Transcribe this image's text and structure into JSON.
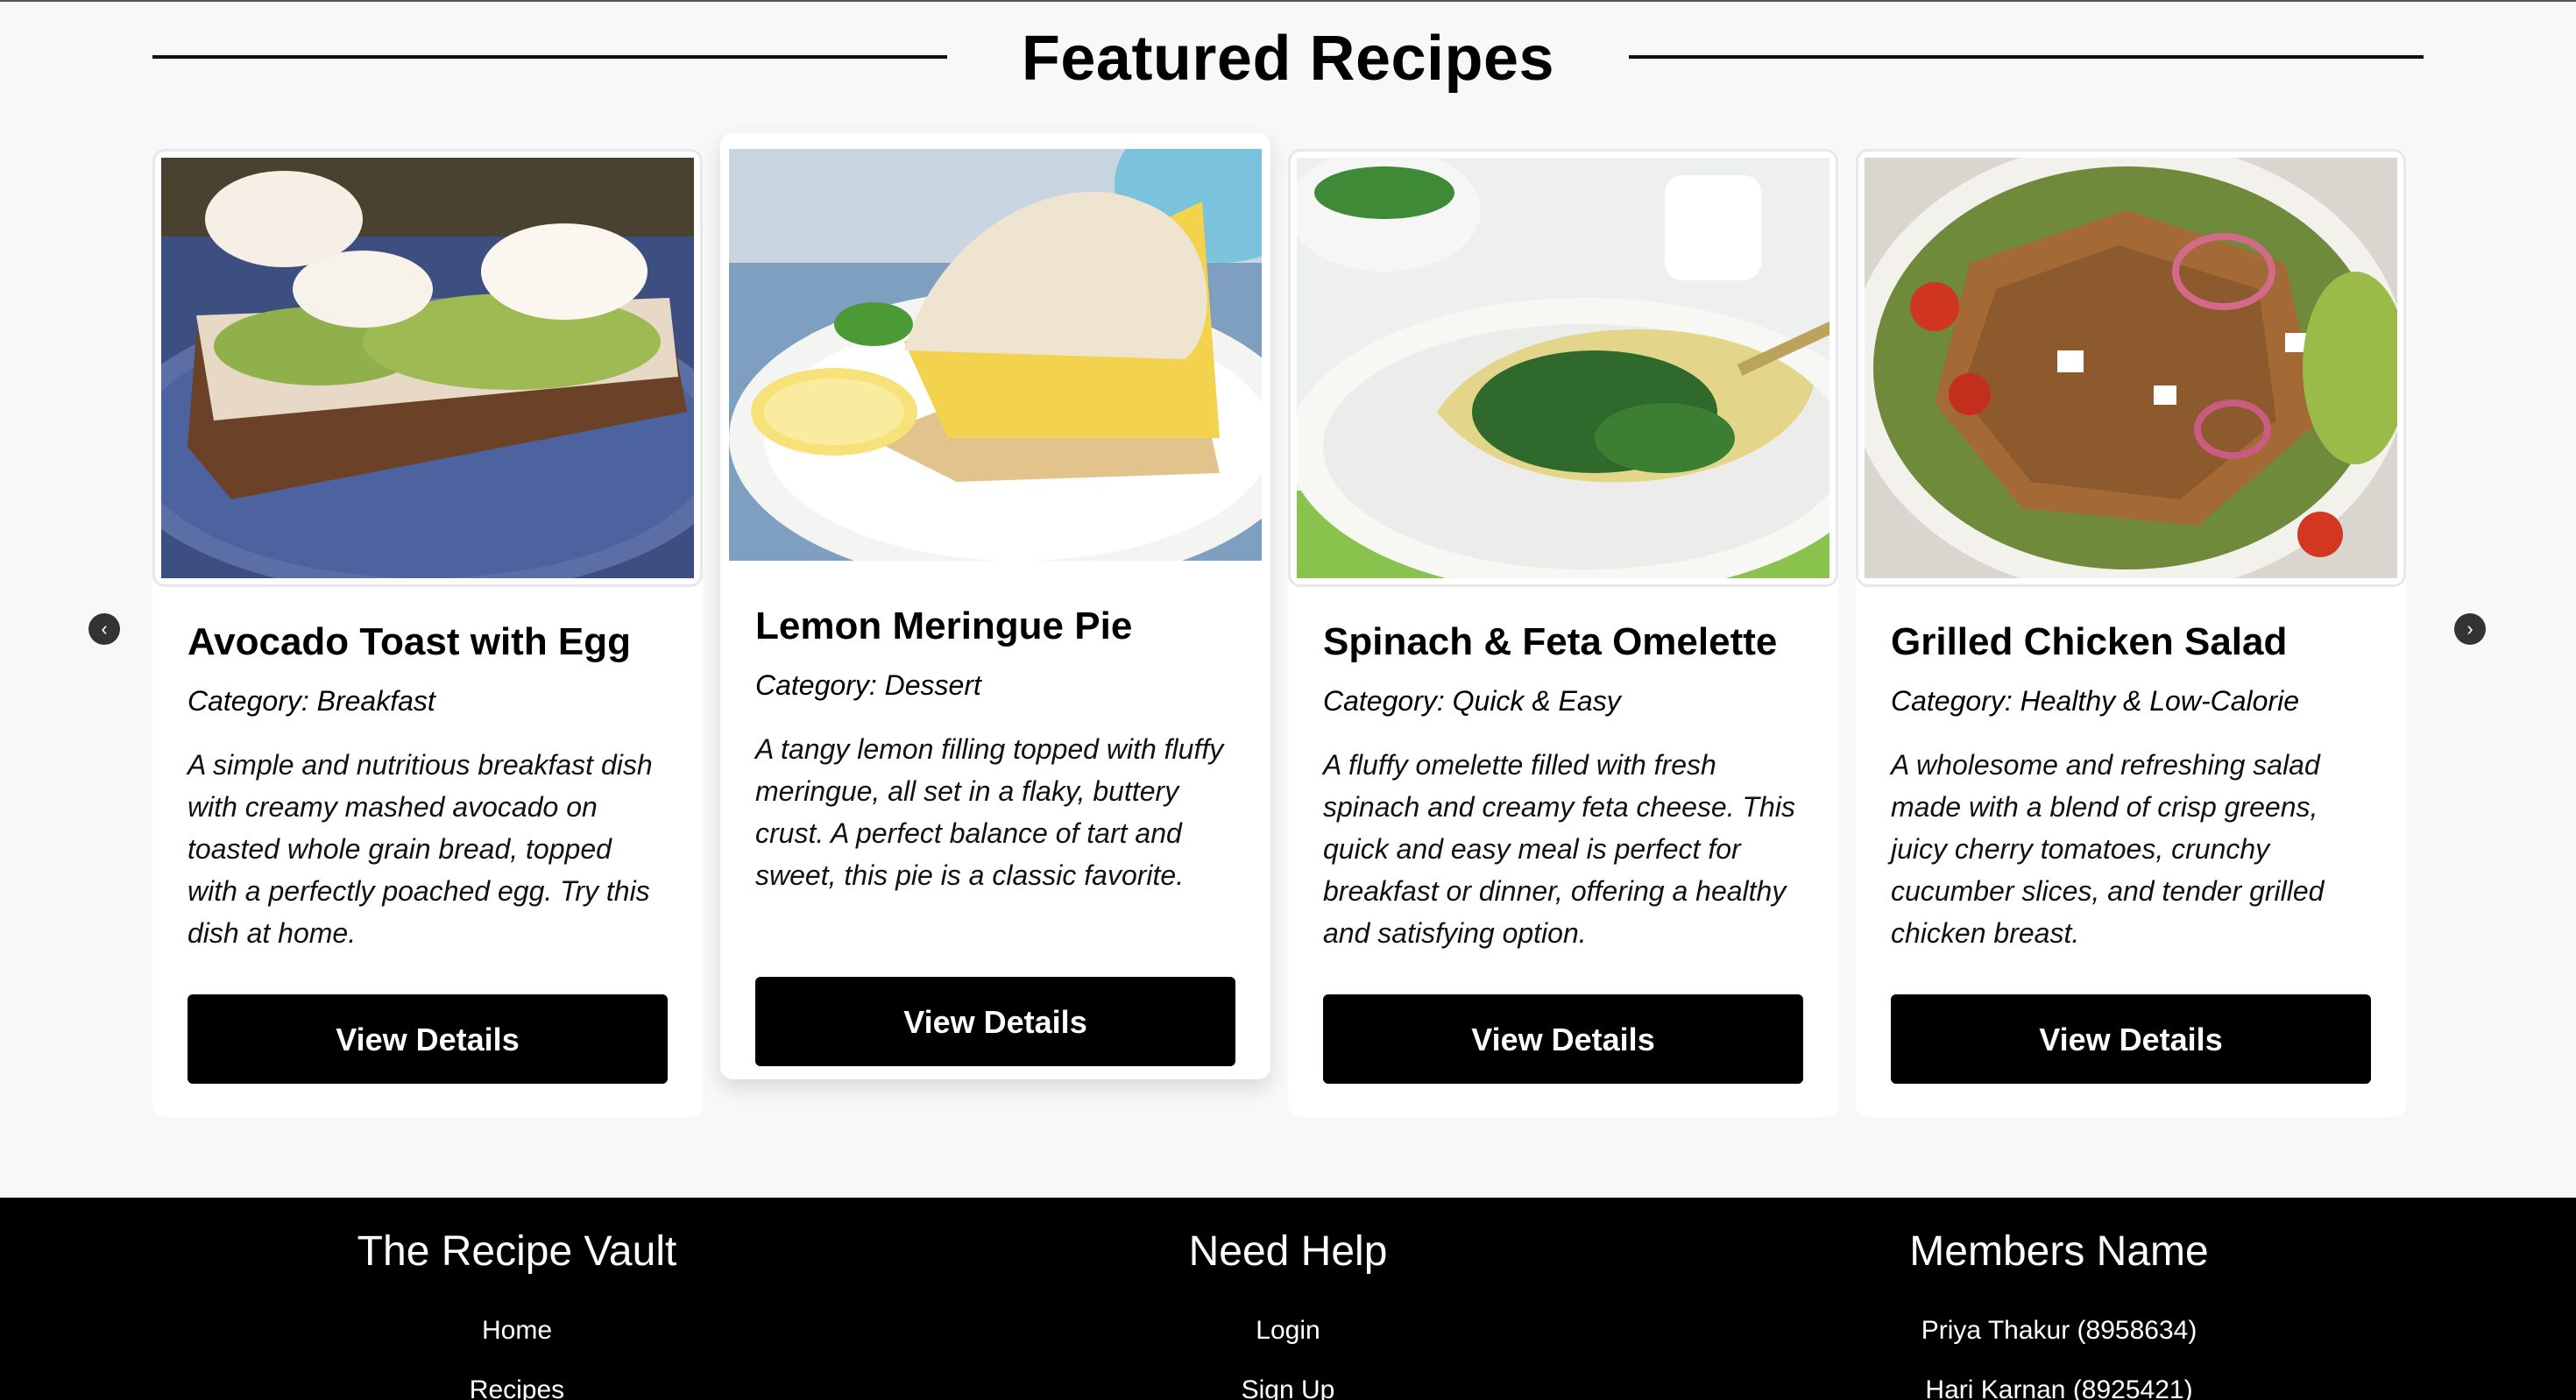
{
  "section": {
    "title": "Featured Recipes"
  },
  "carousel": {
    "prev_icon": "chevron-left-circle",
    "next_icon": "chevron-right-circle",
    "cards": [
      {
        "title": "Avocado Toast with Egg",
        "category": "Category: Breakfast",
        "description": "A simple and nutritious breakfast dish with creamy mashed avocado on toasted whole grain bread, topped with a perfectly poached egg. Try this dish at home.",
        "button": "View Details"
      },
      {
        "title": "Lemon Meringue Pie",
        "category": "Category: Dessert",
        "description": "A tangy lemon filling topped with fluffy meringue, all set in a flaky, buttery crust. A perfect balance of tart and sweet, this pie is a classic favorite.",
        "button": "View Details"
      },
      {
        "title": "Spinach & Feta Omelette",
        "category": "Category: Quick & Easy",
        "description": "A fluffy omelette filled with fresh spinach and creamy feta cheese. This quick and easy meal is perfect for breakfast or dinner, offering a healthy and satisfying option.",
        "button": "View Details"
      },
      {
        "title": "Grilled Chicken Salad",
        "category": "Category: Healthy & Low-Calorie",
        "description": "A wholesome and refreshing salad made with a blend of crisp greens, juicy cherry tomatoes, crunchy cucumber slices, and tender grilled chicken breast.",
        "button": "View Details"
      }
    ]
  },
  "footer": {
    "brand": {
      "heading": "The Recipe Vault",
      "links": [
        "Home",
        "Recipes"
      ]
    },
    "help": {
      "heading": "Need Help",
      "links": [
        "Login",
        "Sign Up"
      ]
    },
    "members": {
      "heading": "Members Name",
      "names": [
        "Priya Thakur (8958634)",
        "Hari Karnan (8925421)"
      ]
    }
  }
}
